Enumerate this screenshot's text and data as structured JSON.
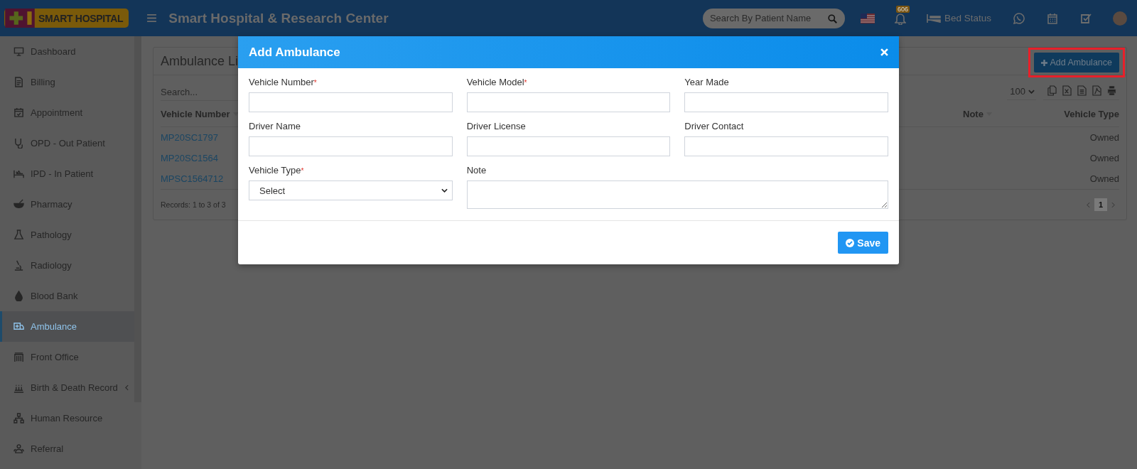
{
  "header": {
    "logo": "SMART HOSPITAL",
    "title": "Smart Hospital & Research Center",
    "search": {
      "placeholder": "Search By Patient Name"
    },
    "notifications": "606",
    "bed_status": "Bed Status"
  },
  "sidebar": {
    "items": [
      {
        "label": "Dashboard",
        "selected": false,
        "has_submenu": false
      },
      {
        "label": "Billing",
        "selected": false,
        "has_submenu": false
      },
      {
        "label": "Appointment",
        "selected": false,
        "has_submenu": false
      },
      {
        "label": "OPD - Out Patient",
        "selected": false,
        "has_submenu": false
      },
      {
        "label": "IPD - In Patient",
        "selected": false,
        "has_submenu": false
      },
      {
        "label": "Pharmacy",
        "selected": false,
        "has_submenu": false
      },
      {
        "label": "Pathology",
        "selected": false,
        "has_submenu": false
      },
      {
        "label": "Radiology",
        "selected": false,
        "has_submenu": false
      },
      {
        "label": "Blood Bank",
        "selected": false,
        "has_submenu": false
      },
      {
        "label": "Ambulance",
        "selected": true,
        "has_submenu": false
      },
      {
        "label": "Front Office",
        "selected": false,
        "has_submenu": false
      },
      {
        "label": "Birth & Death Record",
        "selected": false,
        "has_submenu": true
      },
      {
        "label": "Human Resource",
        "selected": false,
        "has_submenu": false
      },
      {
        "label": "Referral",
        "selected": false,
        "has_submenu": false
      }
    ]
  },
  "panel": {
    "title": "Ambulance Li",
    "add_button": "Add Ambulance",
    "search": {
      "placeholder": "Search..."
    },
    "page_size": "100",
    "table": {
      "columns": [
        "Vehicle Number",
        "Note",
        "Vehicle Type"
      ],
      "rows": [
        {
          "vehicle_number": "MP20SC1797",
          "vehicle_type": "Owned"
        },
        {
          "vehicle_number": "MP20SC1564",
          "vehicle_type": "Owned"
        },
        {
          "vehicle_number": "MPSC1564712",
          "vehicle_type": "Owned"
        }
      ]
    },
    "records": "Records: 1 to 3 of 3",
    "pages": [
      {
        "label": "1",
        "selected": true
      }
    ]
  },
  "modal": {
    "title": "Add Ambulance",
    "fields": [
      {
        "label": "Vehicle Number",
        "required": true,
        "kind": "input"
      },
      {
        "label": "Vehicle Model",
        "required": true,
        "kind": "input"
      },
      {
        "label": "Year Made",
        "required": false,
        "kind": "input"
      },
      {
        "label": "Driver Name",
        "required": false,
        "kind": "input"
      },
      {
        "label": "Driver License",
        "required": false,
        "kind": "input"
      },
      {
        "label": "Driver Contact",
        "required": false,
        "kind": "input"
      },
      {
        "label": "Vehicle Type",
        "required": true,
        "kind": "select",
        "value": "Select"
      },
      {
        "label": "Note",
        "required": false,
        "kind": "textarea"
      }
    ],
    "required_mark": "*",
    "save_button": "Save"
  }
}
